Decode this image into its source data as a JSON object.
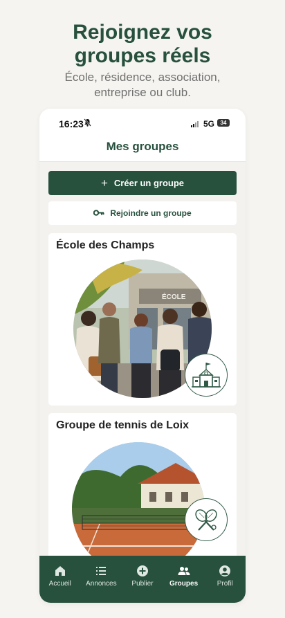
{
  "hero": {
    "title_line1": "Rejoignez vos",
    "title_line2": "groupes réels",
    "subtitle_line1": "École, résidence, association,",
    "subtitle_line2": "entreprise ou club."
  },
  "status_bar": {
    "time": "16:23",
    "network": "5G",
    "battery": "34"
  },
  "app": {
    "title": "Mes groupes",
    "create_button": "Créer un groupe",
    "join_button": "Rejoindre un groupe"
  },
  "groups": [
    {
      "name": "École des Champs",
      "emblem": "school-icon",
      "photo_sign": "ÉCOLE"
    },
    {
      "name": "Groupe de tennis de Loix",
      "emblem": "tennis-rackets-icon"
    }
  ],
  "nav": [
    {
      "label": "Accueil",
      "icon": "home-icon"
    },
    {
      "label": "Annonces",
      "icon": "list-icon"
    },
    {
      "label": "Publier",
      "icon": "plus-circle-icon"
    },
    {
      "label": "Groupes",
      "icon": "group-icon",
      "active": true
    },
    {
      "label": "Profil",
      "icon": "profile-icon"
    }
  ],
  "colors": {
    "brand_green": "#27503d",
    "background": "#f5f4f0",
    "card": "#ffffff"
  }
}
